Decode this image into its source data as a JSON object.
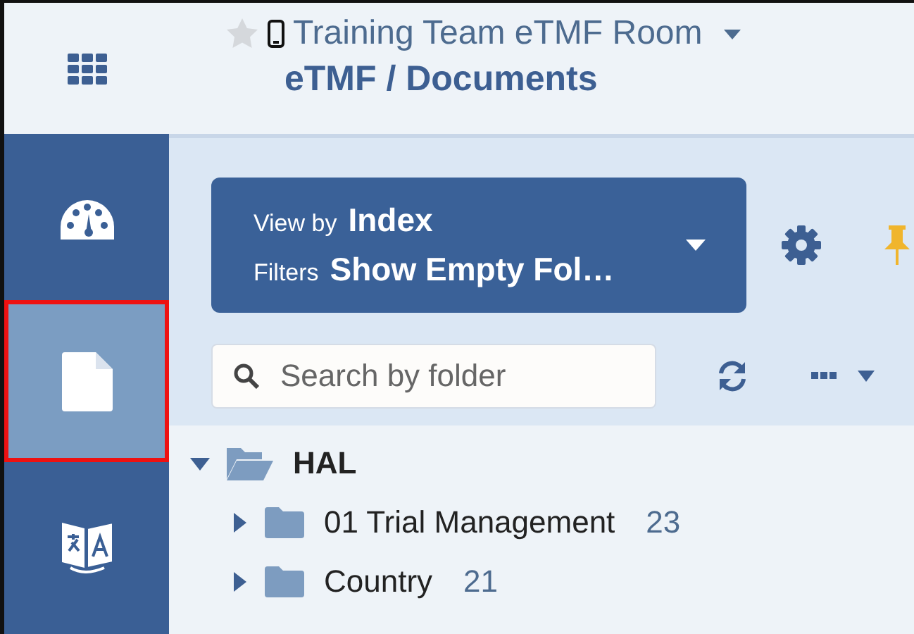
{
  "header": {
    "favorite": false,
    "title": "Training Team eTMF Room",
    "subtitle": "eTMF / Documents"
  },
  "sidebar": {
    "items": [
      {
        "kind": "dashboard",
        "selected": false
      },
      {
        "kind": "documents",
        "selected": true
      },
      {
        "kind": "translate",
        "selected": false
      }
    ]
  },
  "toolbar": {
    "view_by_label": "View by",
    "view_by_value": "Index",
    "filters_label": "Filters",
    "filters_value": "Show Empty Fol…"
  },
  "search": {
    "placeholder": "Search by folder"
  },
  "tree": [
    {
      "name": "HAL",
      "expanded": true,
      "children": [
        {
          "name": "01 Trial Management",
          "count": "23",
          "expanded": false
        },
        {
          "name": "Country",
          "count": "21",
          "expanded": false
        }
      ]
    }
  ]
}
